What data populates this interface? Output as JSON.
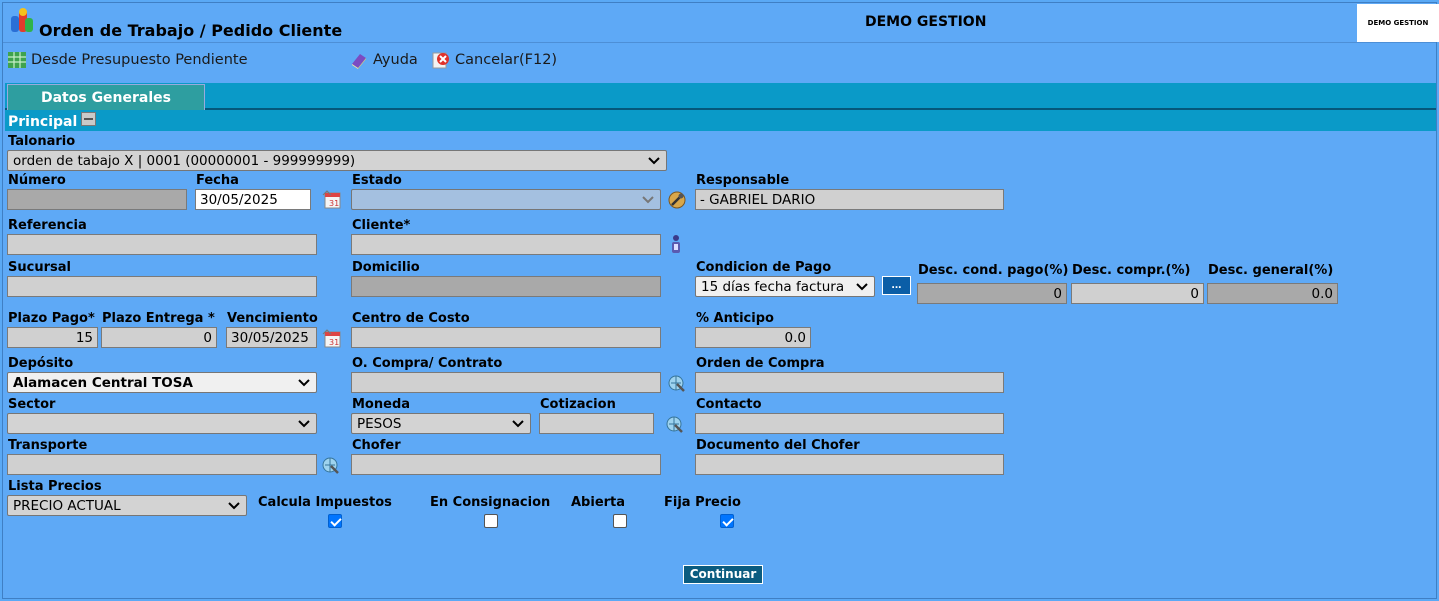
{
  "app": {
    "title": "Orden de Trabajo / Pedido Cliente",
    "company": "DEMO GESTION",
    "company_logo_text": "DEMO GESTION"
  },
  "toolbar": {
    "desde_presupuesto": "Desde Presupuesto Pendiente",
    "ayuda": "Ayuda",
    "cancelar": "Cancelar(F12)"
  },
  "tabs": {
    "datos_generales": "Datos Generales"
  },
  "section": {
    "principal": "Principal"
  },
  "fields": {
    "talonario": {
      "label": "Talonario",
      "value": "orden de tabajo X | 0001 (00000001 - 999999999)"
    },
    "numero": {
      "label": "Número",
      "value": ""
    },
    "fecha": {
      "label": "Fecha",
      "value": "30/05/2025"
    },
    "estado": {
      "label": "Estado",
      "value": ""
    },
    "responsable": {
      "label": "Responsable",
      "value": "- GABRIEL DARIO"
    },
    "referencia": {
      "label": "Referencia",
      "value": ""
    },
    "cliente": {
      "label": "Cliente*",
      "value": ""
    },
    "sucursal": {
      "label": "Sucursal",
      "value": ""
    },
    "domicilio": {
      "label": "Domicilio",
      "value": ""
    },
    "condicion_pago": {
      "label": "Condicion de Pago",
      "value": "15 días fecha factura",
      "button": "..."
    },
    "desc_cond_pago": {
      "label": "Desc. cond. pago(%)",
      "value": "0"
    },
    "desc_compr": {
      "label": "Desc. compr.(%)",
      "value": "0"
    },
    "desc_general": {
      "label": "Desc. general(%)",
      "value": "0.0"
    },
    "plazo_pago": {
      "label": "Plazo Pago*",
      "value": "15"
    },
    "plazo_entrega": {
      "label": "Plazo Entrega *",
      "value": "0"
    },
    "vencimiento": {
      "label": "Vencimiento",
      "value": "30/05/2025"
    },
    "centro_costo": {
      "label": "Centro de Costo",
      "value": ""
    },
    "anticipo": {
      "label": "% Anticipo",
      "value": "0.0"
    },
    "deposito": {
      "label": "Depósito",
      "value": "Alamacen Central TOSA"
    },
    "o_compra_contrato": {
      "label": "O. Compra/ Contrato",
      "value": ""
    },
    "orden_compra": {
      "label": "Orden de Compra",
      "value": ""
    },
    "sector": {
      "label": "Sector",
      "value": ""
    },
    "moneda": {
      "label": "Moneda",
      "value": "PESOS"
    },
    "cotizacion": {
      "label": "Cotizacion",
      "value": ""
    },
    "contacto": {
      "label": "Contacto",
      "value": ""
    },
    "transporte": {
      "label": "Transporte",
      "value": ""
    },
    "chofer": {
      "label": "Chofer",
      "value": ""
    },
    "documento_chofer": {
      "label": "Documento del Chofer",
      "value": ""
    },
    "lista_precios": {
      "label": "Lista Precios",
      "value": "PRECIO ACTUAL"
    },
    "calcula_impuestos": {
      "label": "Calcula Impuestos",
      "checked": true
    },
    "en_consignacion": {
      "label": "En Consignacion",
      "checked": false
    },
    "abierta": {
      "label": "Abierta",
      "checked": false
    },
    "fija_precio": {
      "label": "Fija Precio",
      "checked": true
    }
  },
  "actions": {
    "continuar": "Continuar"
  }
}
